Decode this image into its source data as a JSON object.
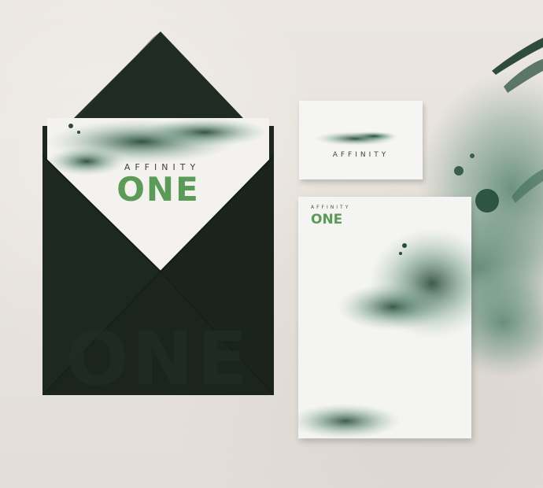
{
  "brand": {
    "envelope_small_word": "AFFINITY",
    "envelope_big_word": "ONE",
    "envelope_emboss_word": "ONE",
    "business_card_word": "AFFINITY",
    "letterhead_small_word": "AFFINITY",
    "letterhead_big_word": "ONE"
  },
  "colors": {
    "background": "#e8e3dd",
    "envelope": "#1f2a22",
    "brand_green": "#5c9a58",
    "watercolor_green": "#2f5a3d"
  }
}
